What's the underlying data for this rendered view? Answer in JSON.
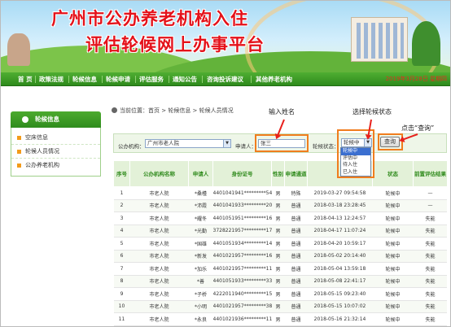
{
  "banner": {
    "title_line1": "广州市公办养老机构入住",
    "title_line2": "评估轮候网上办事平台"
  },
  "nav": {
    "items": [
      "首 页",
      "政策法规",
      "轮候信息",
      "轮候申请",
      "评估服务",
      "通知公告",
      "咨询投诉建议",
      "其他养老机构"
    ],
    "date": "2019年3月28日 星期四"
  },
  "sidebar": {
    "title": "轮候信息",
    "items": [
      "空床信息",
      "轮候人员情况",
      "公办养老机构"
    ]
  },
  "breadcrumb": {
    "label": "当前位置：",
    "path": "首页 > 轮候信息 > 轮候人员情况"
  },
  "search": {
    "org_label": "公办机构：",
    "org_value": "广州市老人院",
    "name_label": "申请人：",
    "name_value": "张三",
    "status_label": "轮候状态：",
    "status_value": "轮候中",
    "status_options": [
      "轮候中",
      "评估中",
      "待入住",
      "已入住"
    ],
    "query_label": "查询"
  },
  "annotations": {
    "name": "输入姓名",
    "status": "选择轮候状态",
    "query": "点击“查询”"
  },
  "table": {
    "headers": [
      "序号",
      "公办机构名称",
      "申请人",
      "身份证号",
      "性别",
      "申请通道",
      "",
      "状态",
      "前置评估结果"
    ],
    "rows": [
      [
        "1",
        "市老人院",
        "*桑槿",
        "4401041941*********54",
        "男",
        "特殊",
        "2019-03-27 09:54:58",
        "轮候中",
        "—"
      ],
      [
        "2",
        "市老人院",
        "*沛霞",
        "4401041933*********20",
        "男",
        "普通",
        "2018-03-18 23:28:45",
        "轮候中",
        "—"
      ],
      [
        "3",
        "市老人院",
        "*耀冬",
        "4401051951*********16",
        "男",
        "普通",
        "2018-04-13 12:24:57",
        "轮候中",
        "失能"
      ],
      [
        "4",
        "市老人院",
        "*光勤",
        "3728221957*********17",
        "男",
        "普通",
        "2018-04-17 11:07:24",
        "轮候中",
        "失能"
      ],
      [
        "5",
        "市老人院",
        "*国雄",
        "4401051934*********14",
        "男",
        "普通",
        "2018-04-20 10:59:17",
        "轮候中",
        "失能"
      ],
      [
        "6",
        "市老人院",
        "*新发",
        "4401021957*********16",
        "男",
        "普通",
        "2018-05-02 20:14:40",
        "轮候中",
        "失能"
      ],
      [
        "7",
        "市老人院",
        "*加乐",
        "4401021957*********11",
        "男",
        "普通",
        "2018-05-04 13:59:18",
        "轮候中",
        "失能"
      ],
      [
        "8",
        "市老人院",
        "*善",
        "4401051933*********33",
        "男",
        "普通",
        "2018-05-08 22:41:17",
        "轮候中",
        "失能"
      ],
      [
        "9",
        "市老人院",
        "*子桥",
        "4222011940*********15",
        "男",
        "普通",
        "2018-05-15 09:23:40",
        "轮候中",
        "失能"
      ],
      [
        "10",
        "市老人院",
        "*小明",
        "4401021957*********38",
        "男",
        "普通",
        "2018-05-15 10:07:02",
        "轮候中",
        "失能"
      ],
      [
        "11",
        "市老人院",
        "*永良",
        "4401021936*********11",
        "男",
        "普通",
        "2018-05-16 21:32:14",
        "轮候中",
        "失能"
      ]
    ]
  },
  "colors": {
    "nav_green": "#2e8a1c",
    "title_red": "#e4111a",
    "highlight_orange": "#f07d1e",
    "arrow_red": "#e8201c"
  }
}
